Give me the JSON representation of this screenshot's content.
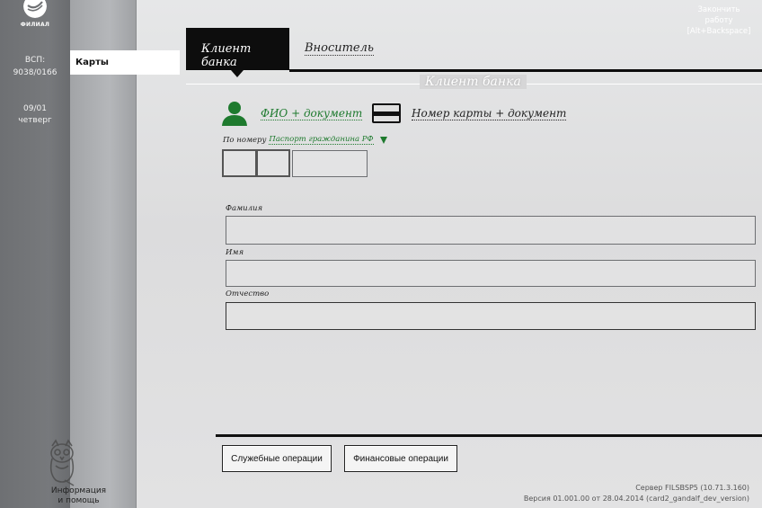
{
  "sidebar": {
    "logo_text": "ФИЛИАЛ",
    "vsp_label": "ВСП:",
    "vsp_value": "9038/0166",
    "date": "09/01",
    "weekday": "четверг",
    "help_line1": "Информация",
    "help_line2": "и помощь"
  },
  "menu": {
    "cards": "Карты"
  },
  "exit": {
    "line1": "Закончить",
    "line2": "работу",
    "line3": "[Alt+Backspace]"
  },
  "tabs": [
    {
      "label": "Клиент банка",
      "active": true
    },
    {
      "label": "Вноситель",
      "active": false
    }
  ],
  "section_title": "Клиент банка",
  "search_modes": {
    "fio": "ФИО + документ",
    "card": "Номер карты + документ"
  },
  "document": {
    "prefix": "По номеру",
    "type": "Паспорт гражданина РФ",
    "series1": "",
    "series2": "",
    "number": ""
  },
  "fields": {
    "lastname_label": "Фамилия",
    "lastname_value": "",
    "firstname_label": "Имя",
    "firstname_value": "",
    "patronymic_label": "Отчество",
    "patronymic_value": ""
  },
  "buttons": {
    "service": "Служебные операции",
    "financial": "Финансовые операции"
  },
  "footer": {
    "server": "Сервер FILSBSP5 (10.71.3.160)",
    "version": "Версия 01.001.00 от 28.04.2014 (card2_gandalf_dev_version)"
  },
  "colors": {
    "accent_green": "#1e7a2e",
    "dark": "#0d0d0d"
  }
}
